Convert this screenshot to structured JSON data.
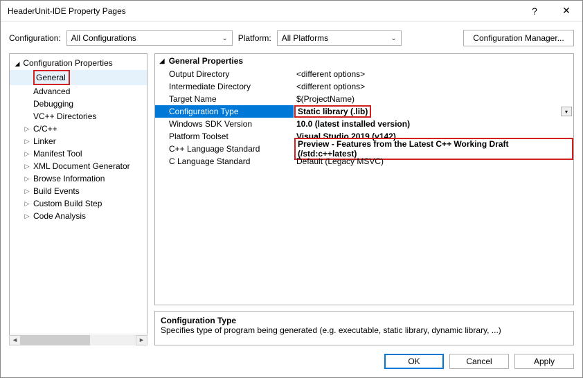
{
  "window": {
    "title": "HeaderUnit-IDE Property Pages"
  },
  "config_row": {
    "config_label": "Configuration:",
    "config_value": "All Configurations",
    "platform_label": "Platform:",
    "platform_value": "All Platforms",
    "cfgmgr": "Configuration Manager..."
  },
  "tree": {
    "root": "Configuration Properties",
    "items": [
      {
        "label": "General",
        "expandable": false,
        "selected": true,
        "redbox": true
      },
      {
        "label": "Advanced",
        "expandable": false
      },
      {
        "label": "Debugging",
        "expandable": false
      },
      {
        "label": "VC++ Directories",
        "expandable": false
      },
      {
        "label": "C/C++",
        "expandable": true
      },
      {
        "label": "Linker",
        "expandable": true
      },
      {
        "label": "Manifest Tool",
        "expandable": true
      },
      {
        "label": "XML Document Generator",
        "expandable": true
      },
      {
        "label": "Browse Information",
        "expandable": true
      },
      {
        "label": "Build Events",
        "expandable": true
      },
      {
        "label": "Custom Build Step",
        "expandable": true
      },
      {
        "label": "Code Analysis",
        "expandable": true
      }
    ]
  },
  "grid": {
    "header": "General Properties",
    "rows": [
      {
        "name": "Output Directory",
        "value": "<different options>"
      },
      {
        "name": "Intermediate Directory",
        "value": "<different options>"
      },
      {
        "name": "Target Name",
        "value": "$(ProjectName)"
      },
      {
        "name": "Configuration Type",
        "value": "Static library (.lib)",
        "selected": true,
        "redval": true
      },
      {
        "name": "Windows SDK Version",
        "value": "10.0 (latest installed version)",
        "bold": true
      },
      {
        "name": "Platform Toolset",
        "value": "Visual Studio 2019 (v142)",
        "bold": true
      },
      {
        "name": "C++ Language Standard",
        "value": "Preview - Features from the Latest C++ Working Draft (/std:c++latest)",
        "redval": true
      },
      {
        "name": "C Language Standard",
        "value": "Default (Legacy MSVC)"
      }
    ]
  },
  "desc": {
    "title": "Configuration Type",
    "text": "Specifies type of program being generated (e.g. executable, static library, dynamic library, ...)"
  },
  "footer": {
    "ok": "OK",
    "cancel": "Cancel",
    "apply": "Apply"
  }
}
